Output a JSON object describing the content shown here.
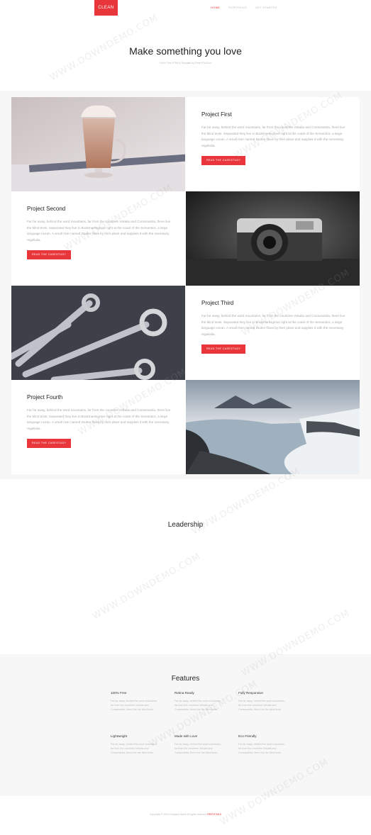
{
  "header": {
    "logo": "CLEAN",
    "nav": [
      "HOME",
      "PORTFOLIO",
      "GET STARTED"
    ]
  },
  "hero": {
    "title": "Make something you love",
    "subtitle": "100% Free HTML5 Template by FreeHTML5.co"
  },
  "projects": [
    {
      "title": "Project First",
      "desc": "Far far away, behind the word mountains, far from the countries Vokalia and Consonantia, there live the blind texts. Separated they live in Bookmarksgrove right at the coast of the Semantics, a large language ocean. A small river named Duden flows by their place and supplies it with the necessary regelialia.",
      "button": "READ THE CASESTUDY"
    },
    {
      "title": "Project Second",
      "desc": "Far far away, behind the word mountains, far from the countries Vokalia and Consonantia, there live the blind texts. Separated they live in Bookmarksgrove right at the coast of the Semantics, a large language ocean. A small river named Duden flows by their place and supplies it with the necessary regelialia.",
      "button": "READ THE CASESTUDY"
    },
    {
      "title": "Project Third",
      "desc": "Far far away, behind the word mountains, far from the countries Vokalia and Consonantia, there live the blind texts. Separated they live in Bookmarksgrove right at the coast of the Semantics, a large language ocean. A small river named Duden flows by their place and supplies it with the necessary regelialia.",
      "button": "READ THE CASESTUDY"
    },
    {
      "title": "Project Fourth",
      "desc": "Far far away, behind the word mountains, far from the countries Vokalia and Consonantia, there live the blind texts. Separated they live in Bookmarksgrove right at the coast of the Semantics, a large language ocean. A small river named Duden flows by their place and supplies it with the necessary regelialia.",
      "button": "READ THE CASESTUDY"
    }
  ],
  "leadership": {
    "title": "Leadership"
  },
  "features": {
    "title": "Features",
    "items": [
      {
        "title": "100% Free",
        "desc": "Far far away, behind the word mountains, far from the countries Vokalia and Consonantia, there live the blind texts."
      },
      {
        "title": "Retina Ready",
        "desc": "Far far away, behind the word mountains, far from the countries Vokalia and Consonantia, there live the blind texts."
      },
      {
        "title": "Fully Responsive",
        "desc": "Far far away, behind the word mountains, far from the countries Vokalia and Consonantia, there live the blind texts."
      },
      {
        "title": "Lightweight",
        "desc": "Far far away, behind the word mountains, far from the countries Vokalia and Consonantia, there live the blind texts."
      },
      {
        "title": "Made with Love",
        "desc": "Far far away, behind the word mountains, far from the countries Vokalia and Consonantia, there live the blind texts."
      },
      {
        "title": "Eco Friendly",
        "desc": "Far far away, behind the word mountains, far from the countries Vokalia and Consonantia, there live the blind texts."
      }
    ]
  },
  "footer": {
    "text": "Copyright © 2016 Company Name All rights reserved",
    "link": "FREEHTML5"
  },
  "watermark": "WWW.DOWNDEMO.COM",
  "colors": {
    "accent": "#e8363a",
    "text": "#222222",
    "muted": "#aaaaaa",
    "section_bg": "#f7f7f7"
  }
}
